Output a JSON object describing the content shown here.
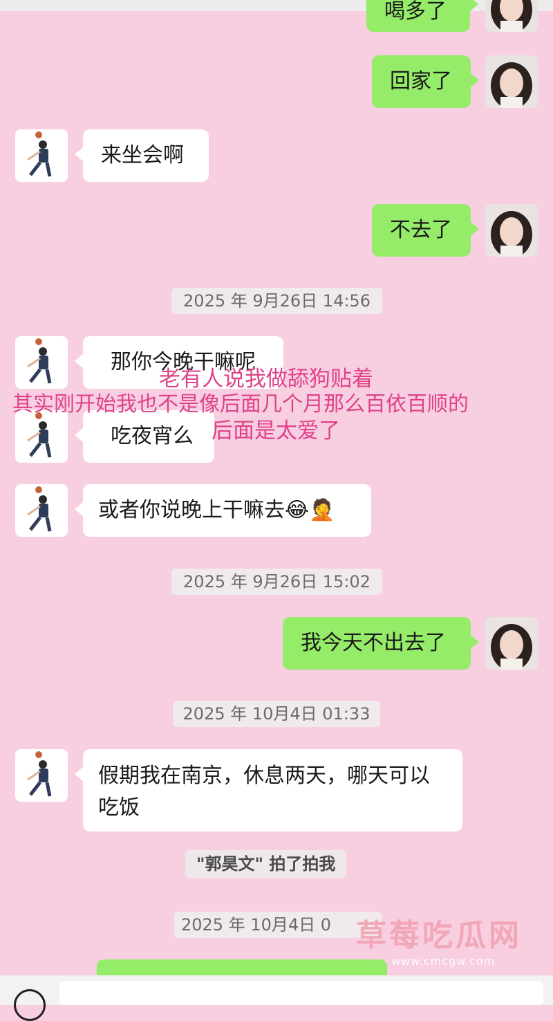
{
  "messages": [
    {
      "side": "out",
      "text": "喝多了"
    },
    {
      "side": "out",
      "text": "回家了"
    },
    {
      "side": "in",
      "text": "来坐会啊"
    },
    {
      "side": "out",
      "text": "不去了"
    },
    {
      "side": "in",
      "text": "那你今晚干嘛呢"
    },
    {
      "side": "in",
      "text": "吃夜宵么"
    },
    {
      "side": "in",
      "text": "或者你说晚上干嘛去😂🤦"
    },
    {
      "side": "out",
      "text": "我今天不出去了"
    },
    {
      "side": "in",
      "text": "假期我在南京，休息两天，哪天可以吃饭"
    }
  ],
  "timestamps": [
    "2025 年 9月26日 14:56",
    "2025 年 9月26日 15:02",
    "2025 年 10月4日 01:33",
    "2025 年 10月4日 0"
  ],
  "system_notice": "\"郭昊文\" 拍了拍我",
  "overlay_caption": [
    "老有人说我做舔狗贴着",
    "其实刚开始我也不是像后面几个月那么百依百顺的",
    "后面是太爱了"
  ],
  "watermark": {
    "name": "草莓吃瓜网",
    "url": "www.cmcgw.com"
  },
  "colors": {
    "background": "#f7cfe0",
    "outgoing_bubble": "#95ec69",
    "incoming_bubble": "#ffffff",
    "overlay_text": "#e0428a"
  }
}
